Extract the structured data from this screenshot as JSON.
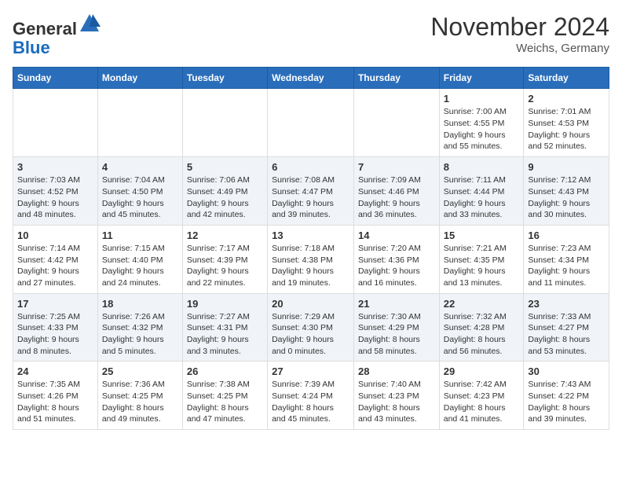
{
  "header": {
    "logo_general": "General",
    "logo_blue": "Blue",
    "month_title": "November 2024",
    "subtitle": "Weichs, Germany"
  },
  "days_of_week": [
    "Sunday",
    "Monday",
    "Tuesday",
    "Wednesday",
    "Thursday",
    "Friday",
    "Saturday"
  ],
  "weeks": [
    [
      {
        "day": "",
        "info": ""
      },
      {
        "day": "",
        "info": ""
      },
      {
        "day": "",
        "info": ""
      },
      {
        "day": "",
        "info": ""
      },
      {
        "day": "",
        "info": ""
      },
      {
        "day": "1",
        "info": "Sunrise: 7:00 AM\nSunset: 4:55 PM\nDaylight: 9 hours and 55 minutes."
      },
      {
        "day": "2",
        "info": "Sunrise: 7:01 AM\nSunset: 4:53 PM\nDaylight: 9 hours and 52 minutes."
      }
    ],
    [
      {
        "day": "3",
        "info": "Sunrise: 7:03 AM\nSunset: 4:52 PM\nDaylight: 9 hours and 48 minutes."
      },
      {
        "day": "4",
        "info": "Sunrise: 7:04 AM\nSunset: 4:50 PM\nDaylight: 9 hours and 45 minutes."
      },
      {
        "day": "5",
        "info": "Sunrise: 7:06 AM\nSunset: 4:49 PM\nDaylight: 9 hours and 42 minutes."
      },
      {
        "day": "6",
        "info": "Sunrise: 7:08 AM\nSunset: 4:47 PM\nDaylight: 9 hours and 39 minutes."
      },
      {
        "day": "7",
        "info": "Sunrise: 7:09 AM\nSunset: 4:46 PM\nDaylight: 9 hours and 36 minutes."
      },
      {
        "day": "8",
        "info": "Sunrise: 7:11 AM\nSunset: 4:44 PM\nDaylight: 9 hours and 33 minutes."
      },
      {
        "day": "9",
        "info": "Sunrise: 7:12 AM\nSunset: 4:43 PM\nDaylight: 9 hours and 30 minutes."
      }
    ],
    [
      {
        "day": "10",
        "info": "Sunrise: 7:14 AM\nSunset: 4:42 PM\nDaylight: 9 hours and 27 minutes."
      },
      {
        "day": "11",
        "info": "Sunrise: 7:15 AM\nSunset: 4:40 PM\nDaylight: 9 hours and 24 minutes."
      },
      {
        "day": "12",
        "info": "Sunrise: 7:17 AM\nSunset: 4:39 PM\nDaylight: 9 hours and 22 minutes."
      },
      {
        "day": "13",
        "info": "Sunrise: 7:18 AM\nSunset: 4:38 PM\nDaylight: 9 hours and 19 minutes."
      },
      {
        "day": "14",
        "info": "Sunrise: 7:20 AM\nSunset: 4:36 PM\nDaylight: 9 hours and 16 minutes."
      },
      {
        "day": "15",
        "info": "Sunrise: 7:21 AM\nSunset: 4:35 PM\nDaylight: 9 hours and 13 minutes."
      },
      {
        "day": "16",
        "info": "Sunrise: 7:23 AM\nSunset: 4:34 PM\nDaylight: 9 hours and 11 minutes."
      }
    ],
    [
      {
        "day": "17",
        "info": "Sunrise: 7:25 AM\nSunset: 4:33 PM\nDaylight: 9 hours and 8 minutes."
      },
      {
        "day": "18",
        "info": "Sunrise: 7:26 AM\nSunset: 4:32 PM\nDaylight: 9 hours and 5 minutes."
      },
      {
        "day": "19",
        "info": "Sunrise: 7:27 AM\nSunset: 4:31 PM\nDaylight: 9 hours and 3 minutes."
      },
      {
        "day": "20",
        "info": "Sunrise: 7:29 AM\nSunset: 4:30 PM\nDaylight: 9 hours and 0 minutes."
      },
      {
        "day": "21",
        "info": "Sunrise: 7:30 AM\nSunset: 4:29 PM\nDaylight: 8 hours and 58 minutes."
      },
      {
        "day": "22",
        "info": "Sunrise: 7:32 AM\nSunset: 4:28 PM\nDaylight: 8 hours and 56 minutes."
      },
      {
        "day": "23",
        "info": "Sunrise: 7:33 AM\nSunset: 4:27 PM\nDaylight: 8 hours and 53 minutes."
      }
    ],
    [
      {
        "day": "24",
        "info": "Sunrise: 7:35 AM\nSunset: 4:26 PM\nDaylight: 8 hours and 51 minutes."
      },
      {
        "day": "25",
        "info": "Sunrise: 7:36 AM\nSunset: 4:25 PM\nDaylight: 8 hours and 49 minutes."
      },
      {
        "day": "26",
        "info": "Sunrise: 7:38 AM\nSunset: 4:25 PM\nDaylight: 8 hours and 47 minutes."
      },
      {
        "day": "27",
        "info": "Sunrise: 7:39 AM\nSunset: 4:24 PM\nDaylight: 8 hours and 45 minutes."
      },
      {
        "day": "28",
        "info": "Sunrise: 7:40 AM\nSunset: 4:23 PM\nDaylight: 8 hours and 43 minutes."
      },
      {
        "day": "29",
        "info": "Sunrise: 7:42 AM\nSunset: 4:23 PM\nDaylight: 8 hours and 41 minutes."
      },
      {
        "day": "30",
        "info": "Sunrise: 7:43 AM\nSunset: 4:22 PM\nDaylight: 8 hours and 39 minutes."
      }
    ]
  ]
}
